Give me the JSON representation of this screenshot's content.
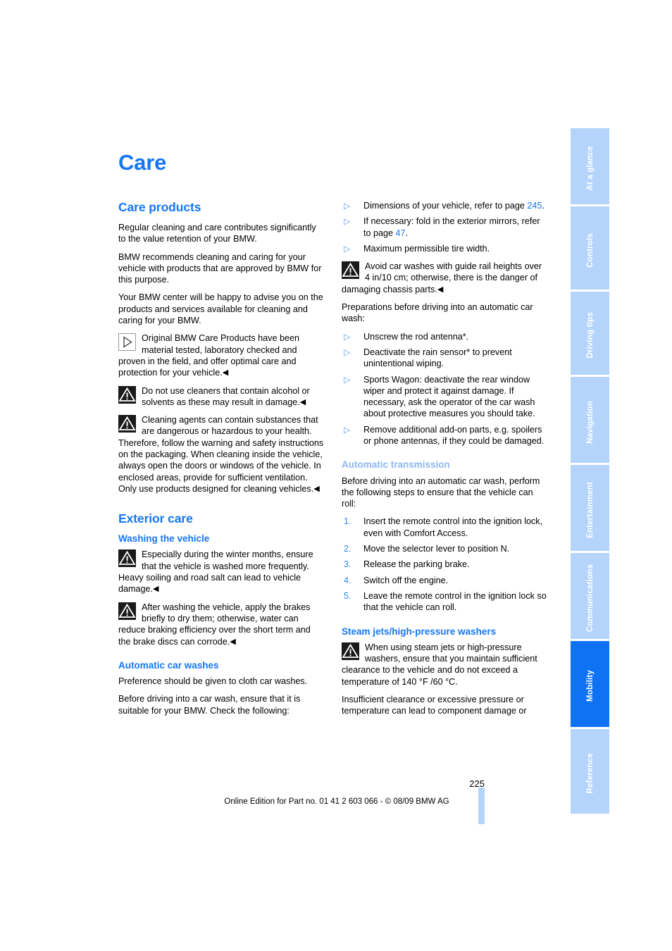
{
  "page": {
    "title": "Care",
    "number": "225",
    "footer_note": "Online Edition for Part no. 01 41 2 603 066 - © 08/09 BMW AG"
  },
  "side_tabs": [
    {
      "label": "At a glance",
      "active": false
    },
    {
      "label": "Controls",
      "active": false
    },
    {
      "label": "Driving tips",
      "active": false
    },
    {
      "label": "Navigation",
      "active": false
    },
    {
      "label": "Entertainment",
      "active": false
    },
    {
      "label": "Communications",
      "active": false
    },
    {
      "label": "Mobility",
      "active": true
    },
    {
      "label": "Reference",
      "active": false
    }
  ],
  "left_column": {
    "care_products_heading": "Care products",
    "p1": "Regular cleaning and care contributes significantly to the value retention of your BMW.",
    "p2": "BMW recommends cleaning and caring for your vehicle with products that are approved by BMW for this purpose.",
    "p3": "Your BMW center will be happy to advise you on the products and services available for cleaning and caring for your BMW.",
    "info_note": "Original BMW Care Products have been material tested, laboratory checked and proven in the field, and offer optimal care and protection for your vehicle.",
    "warning_1": "Do not use cleaners that contain alcohol or solvents as these may result in damage.",
    "warning_2": "Cleaning agents can contain substances that are dangerous or hazardous to your health. Therefore, follow the warning and safety instructions on the packaging. When cleaning inside the vehicle, always open the doors or windows of the vehicle. In enclosed areas, provide for sufficient ventilation. Only use products designed for cleaning vehicles.",
    "exterior_care_heading": "Exterior care",
    "washing_heading": "Washing the vehicle",
    "warning_3": "Especially during the winter months, ensure that the vehicle is washed more frequently. Heavy soiling and road salt can lead to vehicle damage.",
    "warning_4": "After washing the vehicle, apply the brakes briefly to dry them; otherwise, water can reduce braking efficiency over the short term and the brake discs can corrode.",
    "auto_car_washes_heading": "Automatic car washes",
    "p4": "Preference should be given to cloth car washes.",
    "p5": "Before driving into a car wash, ensure that it is suitable for your BMW. Check the following:"
  },
  "right_column": {
    "checklist": [
      {
        "text_before": "Dimensions of your vehicle, refer to page ",
        "ref": "245",
        "text_after": "."
      },
      {
        "text_before": "If necessary: fold in the exterior mirrors, refer to page ",
        "ref": "47",
        "text_after": "."
      },
      {
        "text_before": "Maximum permissible tire width.",
        "ref": "",
        "text_after": ""
      }
    ],
    "warning_5": "Avoid car washes with guide rail heights over 4 in/10 cm; otherwise, there is the danger of damaging chassis parts.",
    "prep_intro": "Preparations before driving into an automatic car wash:",
    "prep_list": [
      "Unscrew the rod antenna*.",
      "Deactivate the rain sensor* to prevent unintentional wiping.",
      "Sports Wagon: deactivate the rear window wiper and protect it against damage. If necessary, ask the operator of the car wash about protective measures you should take.",
      "Remove additional add-on parts, e.g. spoilers or phone antennas, if they could be damaged."
    ],
    "auto_transmission_heading": "Automatic transmission",
    "auto_transmission_intro": "Before driving into an automatic car wash, perform the following steps to ensure that the vehicle can roll:",
    "steps": [
      {
        "num": "1.",
        "text": "Insert the remote control into the ignition lock, even with Comfort Access."
      },
      {
        "num": "2.",
        "text": "Move the selector lever to position N."
      },
      {
        "num": "3.",
        "text": "Release the parking brake."
      },
      {
        "num": "4.",
        "text": "Switch off the engine."
      },
      {
        "num": "5.",
        "text": "Leave the remote control in the ignition lock so that the vehicle can roll."
      }
    ],
    "steam_jets_heading": "Steam jets/high-pressure washers",
    "warning_6": "When using steam jets or high-pressure washers, ensure that you maintain sufficient clearance to the vehicle and do not exceed a temperature of 140 °F /60 °C.",
    "warning_6_cont": "Insufficient clearance or excessive pressure or temperature can lead to component damage or"
  },
  "markers": {
    "end_of_notice": "◀",
    "bullet_arrow": "▷"
  },
  "colors": {
    "heading_blue": "#1577f2",
    "light_blue": "#8cb8f0",
    "tab_blue": "#b4d4fb",
    "tab_active_blue": "#0f72f2"
  }
}
